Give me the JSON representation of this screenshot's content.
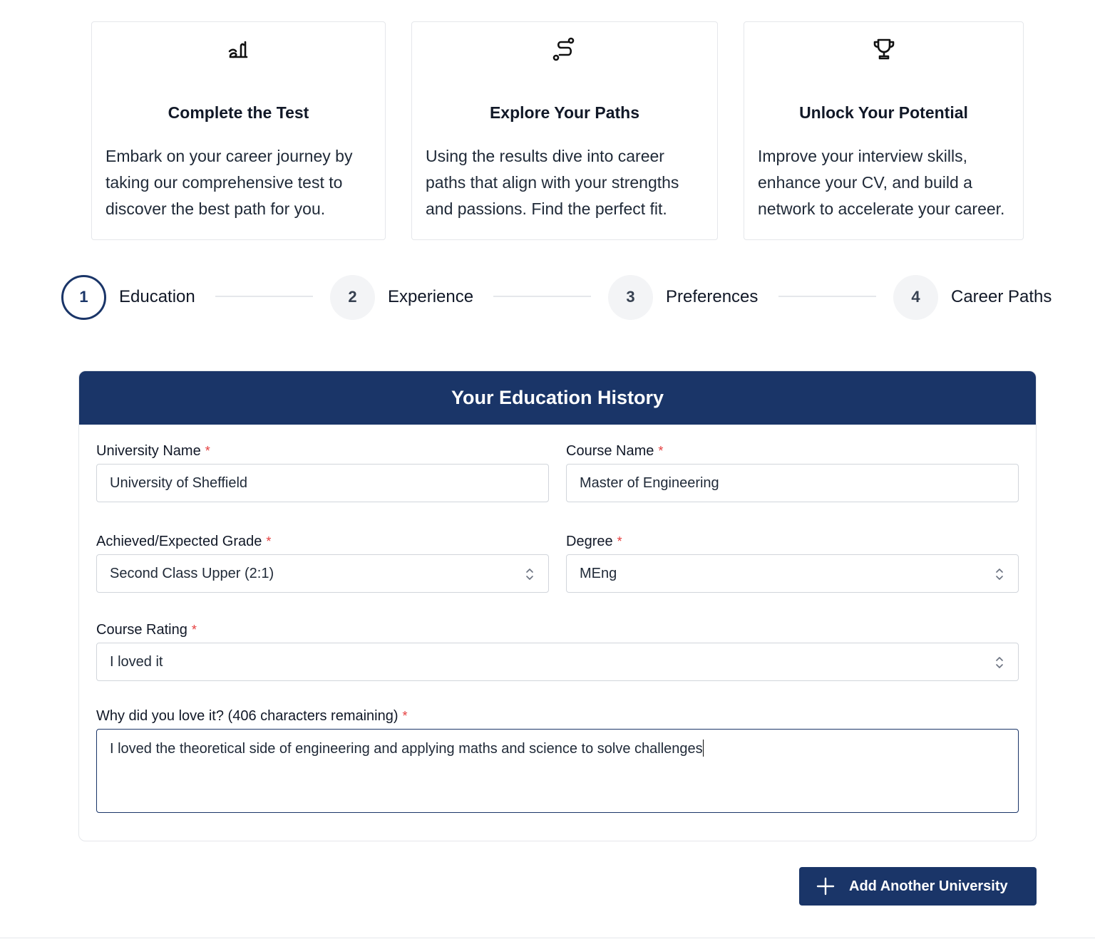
{
  "cards": [
    {
      "icon": "pen-ink-icon",
      "title": "Complete the Test",
      "text": "Embark on your career journey by taking our comprehensive test to discover the best path for you."
    },
    {
      "icon": "route-icon",
      "title": "Explore Your Paths",
      "text": "Using the results dive into career paths that align with your strengths and passions. Find the perfect fit."
    },
    {
      "icon": "trophy-icon",
      "title": "Unlock Your Potential",
      "text": "Improve your interview skills, enhance your CV, and build a network to accelerate your career."
    }
  ],
  "steps": [
    {
      "number": "1",
      "label": "Education",
      "active": true
    },
    {
      "number": "2",
      "label": "Experience",
      "active": false
    },
    {
      "number": "3",
      "label": "Preferences",
      "active": false
    },
    {
      "number": "4",
      "label": "Career Paths",
      "active": false
    }
  ],
  "form": {
    "title": "Your Education History",
    "required_mark": "*",
    "university": {
      "label": "University Name",
      "value": "University of Sheffield"
    },
    "course": {
      "label": "Course Name",
      "value": "Master of Engineering"
    },
    "grade": {
      "label": "Achieved/Expected Grade",
      "value": "Second Class Upper (2:1)"
    },
    "degree": {
      "label": "Degree",
      "value": "MEng"
    },
    "rating": {
      "label": "Course Rating",
      "value": "I loved it"
    },
    "reason": {
      "label": "Why did you love it? (406 characters remaining)",
      "value": "I loved the theoretical side of engineering and applying maths and science to solve challenges"
    }
  },
  "add_button": {
    "label": "Add Another University",
    "icon": "plus-icon"
  },
  "colors": {
    "primary": "#1a3568",
    "required": "#e53e3e",
    "border": "#d1d5db"
  }
}
